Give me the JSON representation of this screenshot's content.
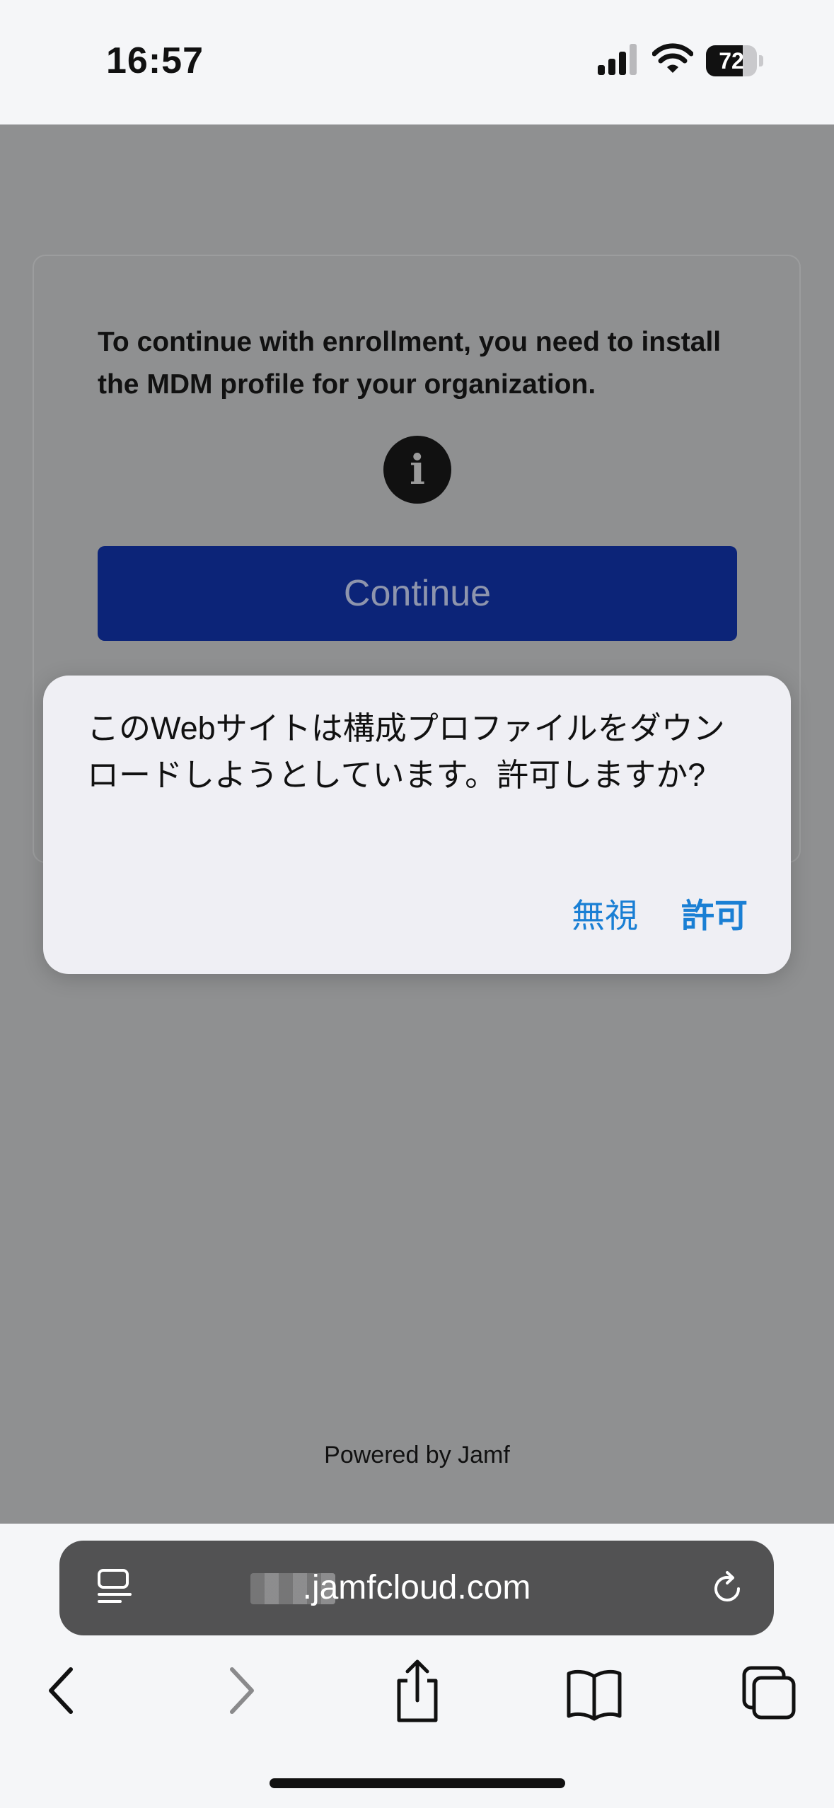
{
  "status_bar": {
    "time": "16:57",
    "battery_percent": "72",
    "battery_level": 0.72,
    "icons": [
      "cellular-signal-icon",
      "wifi-icon",
      "battery-icon"
    ]
  },
  "page": {
    "message": "To continue with enrollment, you need to install the MDM profile for your organization.",
    "continue_label": "Continue",
    "footer": "Powered by Jamf",
    "continue_color": "#0c2478"
  },
  "alert": {
    "message": "このWebサイトは構成プロファイルをダウンロードしようとしています。許可しますか?",
    "ignore_label": "無視",
    "allow_label": "許可",
    "button_color": "#1a7fd4"
  },
  "address_bar": {
    "domain": ".jamfcloud.com",
    "icons": [
      "reader-icon",
      "reload-icon"
    ]
  },
  "toolbar": {
    "icons": [
      "back-icon",
      "forward-icon",
      "share-icon",
      "bookmarks-icon",
      "tabs-icon"
    ]
  }
}
